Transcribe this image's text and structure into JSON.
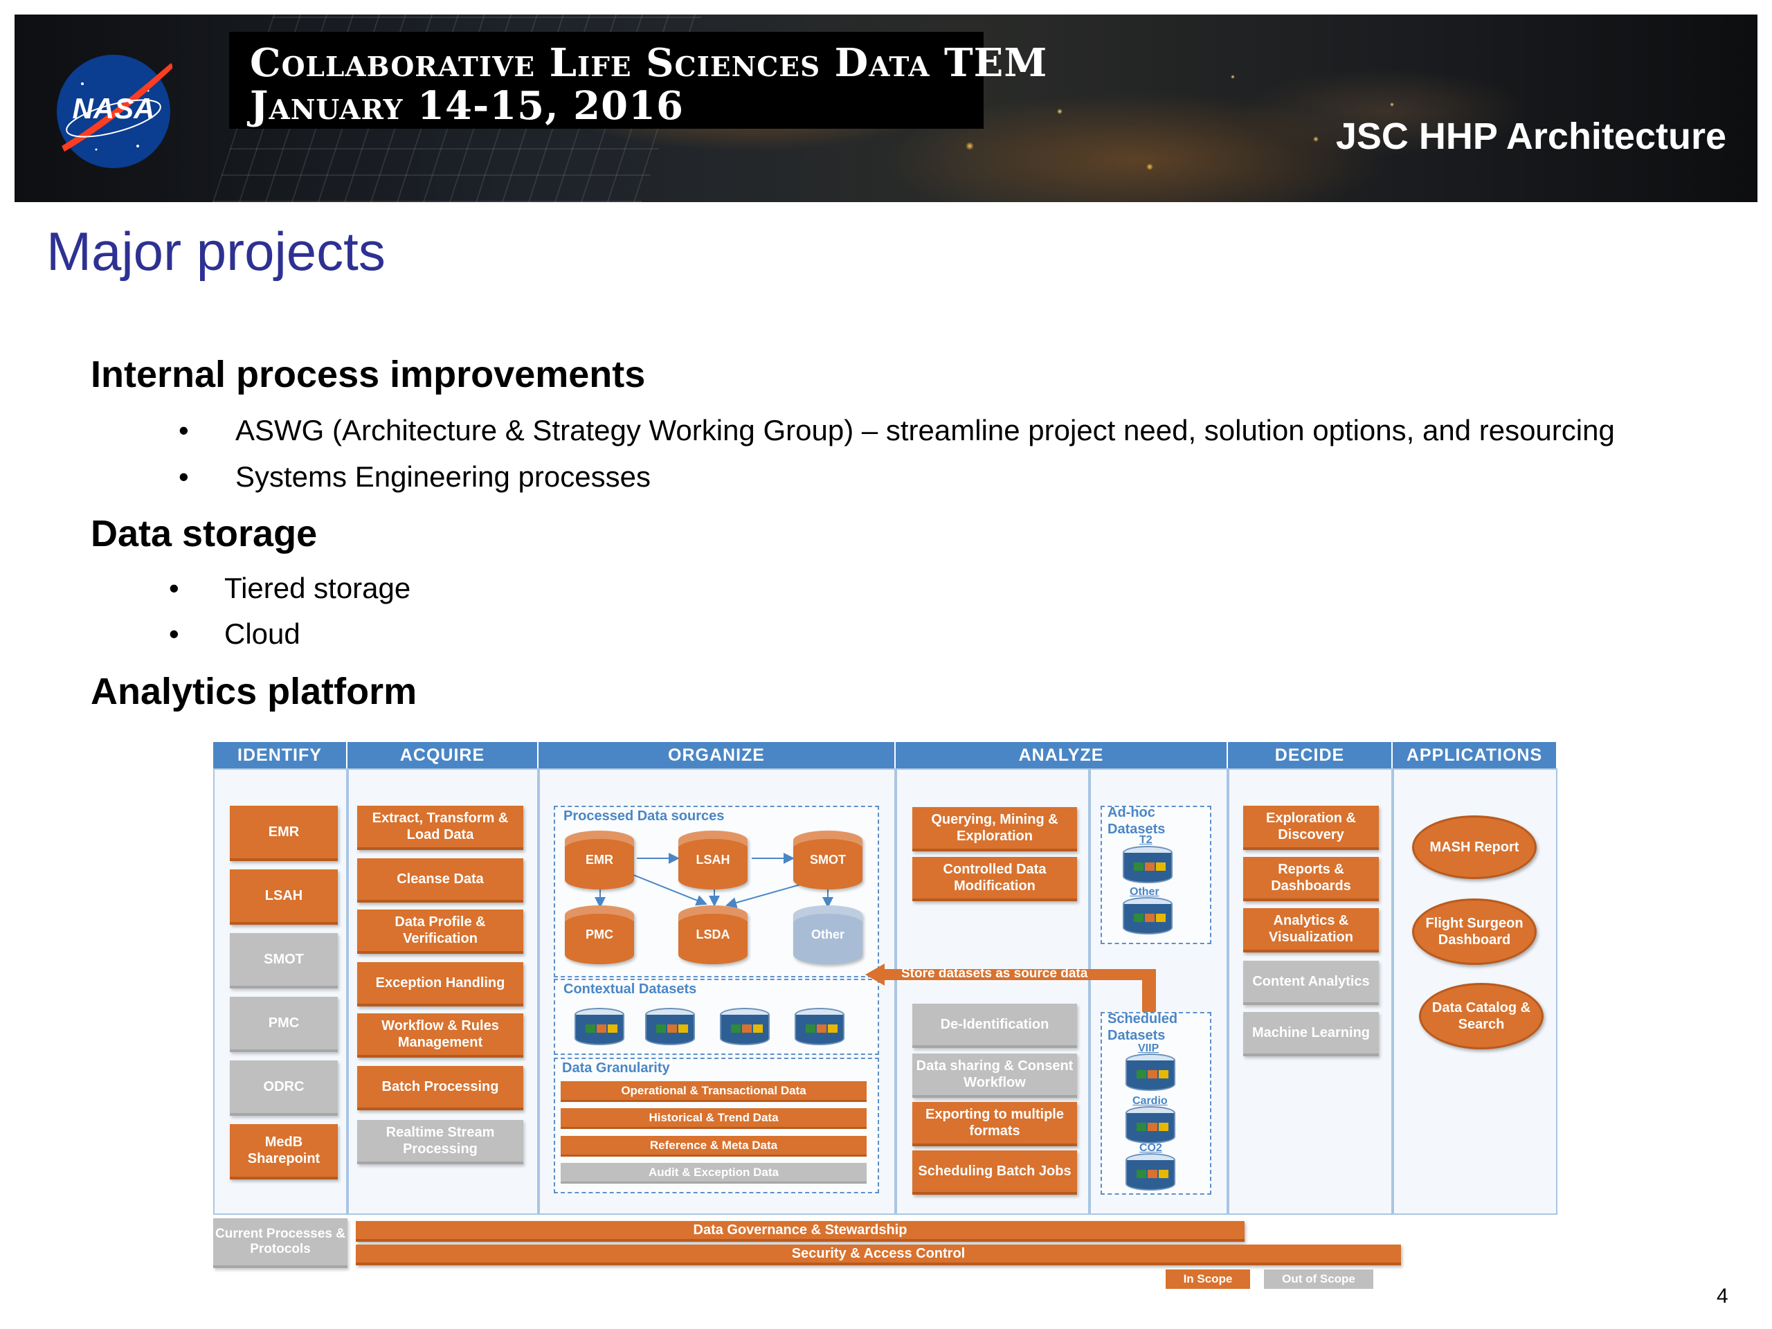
{
  "banner": {
    "logo_text": "NASA",
    "conference_line1": "Collaborative Life Sciences Data TEM",
    "conference_line2": "January 14-15, 2016",
    "right_title": "JSC HHP Architecture"
  },
  "title": "Major projects",
  "sections": [
    {
      "heading": "Internal process improvements",
      "bullets": [
        "ASWG (Architecture & Strategy Working Group) – streamline project need, solution options, and resourcing",
        "Systems Engineering processes"
      ]
    },
    {
      "heading": "Data storage",
      "bullets": [
        "Tiered storage",
        "Cloud"
      ]
    },
    {
      "heading": "Analytics platform",
      "bullets": []
    }
  ],
  "bullet_symbol": "•",
  "diagram": {
    "columns": [
      "IDENTIFY",
      "ACQUIRE",
      "ORGANIZE",
      "ANALYZE",
      "DECIDE",
      "APPLICATIONS"
    ],
    "identify": [
      {
        "label": "EMR",
        "scope": "in"
      },
      {
        "label": "LSAH",
        "scope": "in"
      },
      {
        "label": "SMOT",
        "scope": "out"
      },
      {
        "label": "PMC",
        "scope": "out"
      },
      {
        "label": "ODRC",
        "scope": "out"
      },
      {
        "label": "MedB Sharepoint",
        "scope": "in"
      }
    ],
    "acquire": [
      {
        "label": "Extract, Transform & Load Data",
        "scope": "in"
      },
      {
        "label": "Cleanse Data",
        "scope": "in"
      },
      {
        "label": "Data Profile & Verification",
        "scope": "in"
      },
      {
        "label": "Exception Handling",
        "scope": "in"
      },
      {
        "label": "Workflow & Rules Management",
        "scope": "in"
      },
      {
        "label": "Batch Processing",
        "scope": "in"
      },
      {
        "label": "Realtime Stream Processing",
        "scope": "out"
      }
    ],
    "organize": {
      "processed_label": "Processed Data sources",
      "processed": [
        "EMR",
        "LSAH",
        "SMOT",
        "PMC",
        "LSDA",
        "Other"
      ],
      "contextual_label": "Contextual Datasets",
      "granularity_label": "Data Granularity",
      "granularity": [
        {
          "label": "Operational & Transactional Data",
          "scope": "in"
        },
        {
          "label": "Historical & Trend Data",
          "scope": "in"
        },
        {
          "label": "Reference & Meta Data",
          "scope": "in"
        },
        {
          "label": "Audit & Exception Data",
          "scope": "out"
        }
      ]
    },
    "analyze": [
      {
        "label": "Querying, Mining & Exploration",
        "scope": "in"
      },
      {
        "label": "Controlled Data Modification",
        "scope": "in"
      },
      {
        "label": "De-Identification",
        "scope": "out"
      },
      {
        "label": "Data sharing & Consent Workflow",
        "scope": "out"
      },
      {
        "label": "Exporting to multiple formats",
        "scope": "in"
      },
      {
        "label": "Scheduling Batch Jobs",
        "scope": "in"
      }
    ],
    "adhoc": {
      "label": "Ad-hoc Datasets",
      "items": [
        "T2",
        "Other"
      ]
    },
    "scheduled": {
      "label": "Scheduled Datasets",
      "items": [
        "VIIP",
        "Cardio",
        "CO2"
      ]
    },
    "store_arrow": "Store datasets as source data",
    "decide": [
      {
        "label": "Exploration & Discovery",
        "scope": "in"
      },
      {
        "label": "Reports & Dashboards",
        "scope": "in"
      },
      {
        "label": "Analytics & Visualization",
        "scope": "in"
      },
      {
        "label": "Content Analytics",
        "scope": "out"
      },
      {
        "label": "Machine Learning",
        "scope": "out"
      }
    ],
    "applications": [
      "MASH Report",
      "Flight Surgeon Dashboard",
      "Data Catalog & Search"
    ],
    "current_processes": "Current Processes & Protocols",
    "governance": "Data Governance & Stewardship",
    "security": "Security & Access Control",
    "legend": {
      "in_scope": "In Scope",
      "out_of_scope": "Out of Scope"
    },
    "colors": {
      "in_scope": "#d8722e",
      "out_of_scope": "#bfbfbf",
      "header": "#4a86c5"
    }
  },
  "page_number": "4"
}
